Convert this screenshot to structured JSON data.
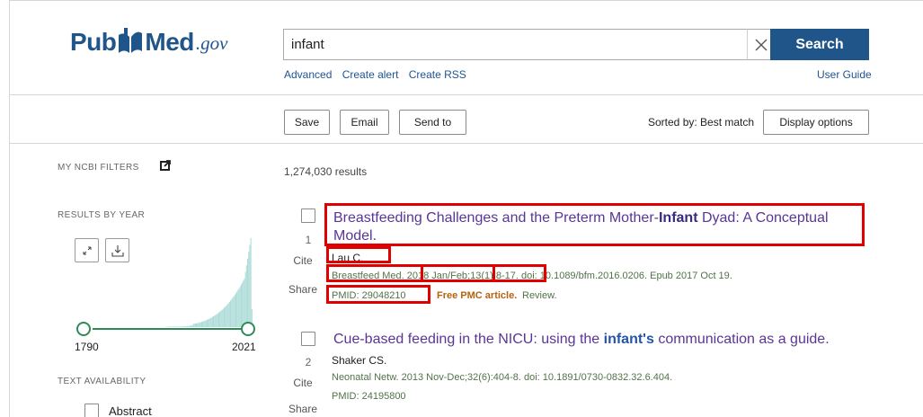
{
  "logo": {
    "pub": "Pub",
    "med": "Med",
    "gov": ".gov"
  },
  "search": {
    "value": "infant",
    "button": "Search",
    "clear": "×"
  },
  "links": {
    "advanced": "Advanced",
    "create_alert": "Create alert",
    "create_rss": "Create RSS",
    "user_guide": "User Guide"
  },
  "toolbar": {
    "save": "Save",
    "email": "Email",
    "send_to": "Send to",
    "sorted_by": "Sorted by: Best match",
    "display_options": "Display options"
  },
  "sidebar": {
    "my_ncbi_filters": "MY NCBI FILTERS",
    "results_by_year": "RESULTS BY YEAR",
    "year_start": "1790",
    "year_end": "2021",
    "text_availability": "TEXT AVAILABILITY",
    "abstract": "Abstract"
  },
  "results": {
    "count": "1,274,030 results",
    "items": [
      {
        "index": "1",
        "title_pre": "Breastfeeding Challenges and the Preterm Mother-",
        "title_bold": "Infant",
        "title_post": " Dyad: A Conceptual",
        "title_line2": "Model.",
        "authors": "Lau C.",
        "journal": "Breastfeed Med.",
        "date": "2018 Jan/Feb",
        "volume": ";13(1):8-17.",
        "doi": "doi: 10.1089/bfm.2016.0206. Epub 2017 Oct 19.",
        "pmid": "PMID: 29048210",
        "free": "Free PMC article.",
        "review": "Review."
      },
      {
        "index": "2",
        "title_pre": "Cue-based feeding in the NICU: using the ",
        "title_bold": "infant's",
        "title_post": " communication as a guide.",
        "authors": "Shaker CS.",
        "citation": "Neonatal Netw. 2013 Nov-Dec;32(6):404-8. doi: 10.1891/0730-0832.32.6.404.",
        "pmid": "PMID: 24195800"
      }
    ],
    "actions": {
      "cite": "Cite",
      "share": "Share"
    }
  },
  "colors": {
    "brand": "#20558a",
    "title": "#5a3595",
    "citation": "#52734a",
    "free": "#b46311",
    "highlight": "#e00000",
    "chart": "#a8dad6"
  }
}
